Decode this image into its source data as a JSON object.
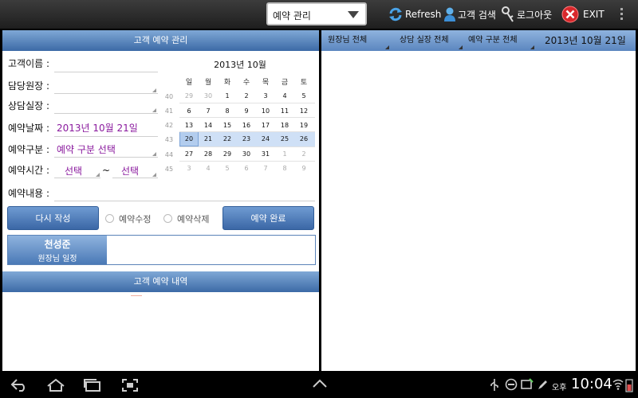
{
  "topbar": {
    "screen_select": "예약 관리",
    "refresh_label": "Refresh",
    "search_label": "고객 검색",
    "logout_label": "로그아웃",
    "exit_label": "EXIT"
  },
  "left": {
    "title": "고객 예약 관리",
    "form": {
      "customer_name_label": "고객이름 :",
      "director_label": "담당원장 :",
      "consultant_label": "상담실장 :",
      "date_label": "예약날짜 :",
      "date_value": "2013년 10월 21일",
      "type_label": "예약구분 :",
      "type_value": "예약 구분 선택",
      "time_label": "예약시간 :",
      "time_from": "선택",
      "time_sep": "~",
      "time_to": "선택",
      "content_label": "예약내용 :"
    },
    "calendar": {
      "title": "2013년 10월",
      "weekdays": [
        "일",
        "월",
        "화",
        "수",
        "목",
        "금",
        "토"
      ],
      "weeks": [
        {
          "num": "40",
          "days": [
            "29",
            "30",
            "1",
            "2",
            "3",
            "4",
            "5"
          ]
        },
        {
          "num": "41",
          "days": [
            "6",
            "7",
            "8",
            "9",
            "10",
            "11",
            "12"
          ]
        },
        {
          "num": "42",
          "days": [
            "13",
            "14",
            "15",
            "16",
            "17",
            "18",
            "19"
          ]
        },
        {
          "num": "43",
          "days": [
            "20",
            "21",
            "22",
            "23",
            "24",
            "25",
            "26"
          ]
        },
        {
          "num": "44",
          "days": [
            "27",
            "28",
            "29",
            "30",
            "31",
            "1",
            "2"
          ]
        },
        {
          "num": "45",
          "days": [
            "3",
            "4",
            "5",
            "6",
            "7",
            "8",
            "9"
          ]
        }
      ]
    },
    "buttons": {
      "rewrite": "다시 작성",
      "modify": "예약수정",
      "delete": "예약삭제",
      "complete": "예약 완료"
    },
    "schedule": {
      "name": "천성준",
      "subtitle": "원장님 일정"
    },
    "history_title": "고객 예약 내역"
  },
  "right": {
    "director_filter": "원장님 전체",
    "consultant_filter": "상담 실장 전체",
    "type_filter": "예약 구분 전체",
    "date": "2013년 10월 21일"
  },
  "system": {
    "ampm": "오후",
    "time": "10:04"
  }
}
